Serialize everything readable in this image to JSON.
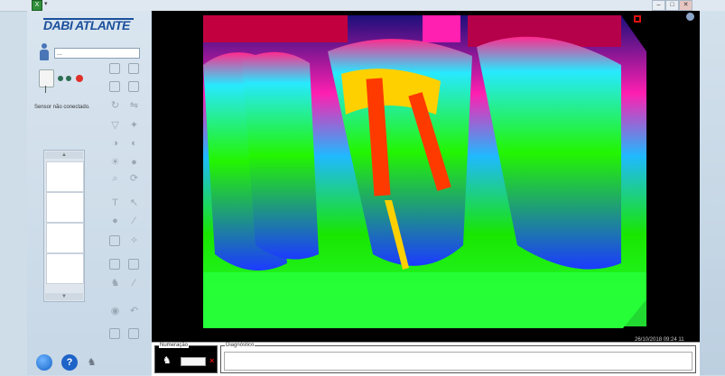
{
  "window": {
    "title_caret": "▾",
    "buttons": [
      "–",
      "□",
      "✕"
    ]
  },
  "brand": {
    "logo": "DABI ATLANTE"
  },
  "patient": {
    "name_value": "..."
  },
  "sensor": {
    "status": "Sensor não conectado.",
    "led_colors": [
      "#2c6e52",
      "#2c6e52",
      "#e0302a"
    ]
  },
  "thumbnails": {
    "scroll_up": "▲",
    "scroll_down": "▼",
    "slots": 4
  },
  "toolbar": {
    "icons": [
      "import-icon",
      "capture-icon",
      "save-icon",
      "delete-icon",
      "rotate-icon",
      "flip-icon",
      "filter-icon",
      "sharpen-icon",
      "contrast-icon",
      "invert-icon",
      "brightness-icon",
      "emboss-icon",
      "zoom-icon",
      "rotate-cw-icon",
      "text-icon",
      "arrow-icon",
      "circle-icon",
      "measure-icon",
      "rect-icon",
      "angle-icon",
      "layers-icon",
      "copy-icon",
      "tooth-tool-icon",
      "pen-icon",
      "reset-icon",
      "undo-icon",
      "window-icon",
      "export-icon"
    ]
  },
  "viewer": {
    "timestamp": "26/10/2018 09:24 11"
  },
  "bottom": {
    "numeracao_label": "Numeração",
    "numeracao_value": "",
    "diagnostico_label": "Diagnóstico",
    "diagnostico_value": ""
  },
  "footer_icons": [
    "settings-icon",
    "help-icon",
    "tooth-footer-icon"
  ]
}
